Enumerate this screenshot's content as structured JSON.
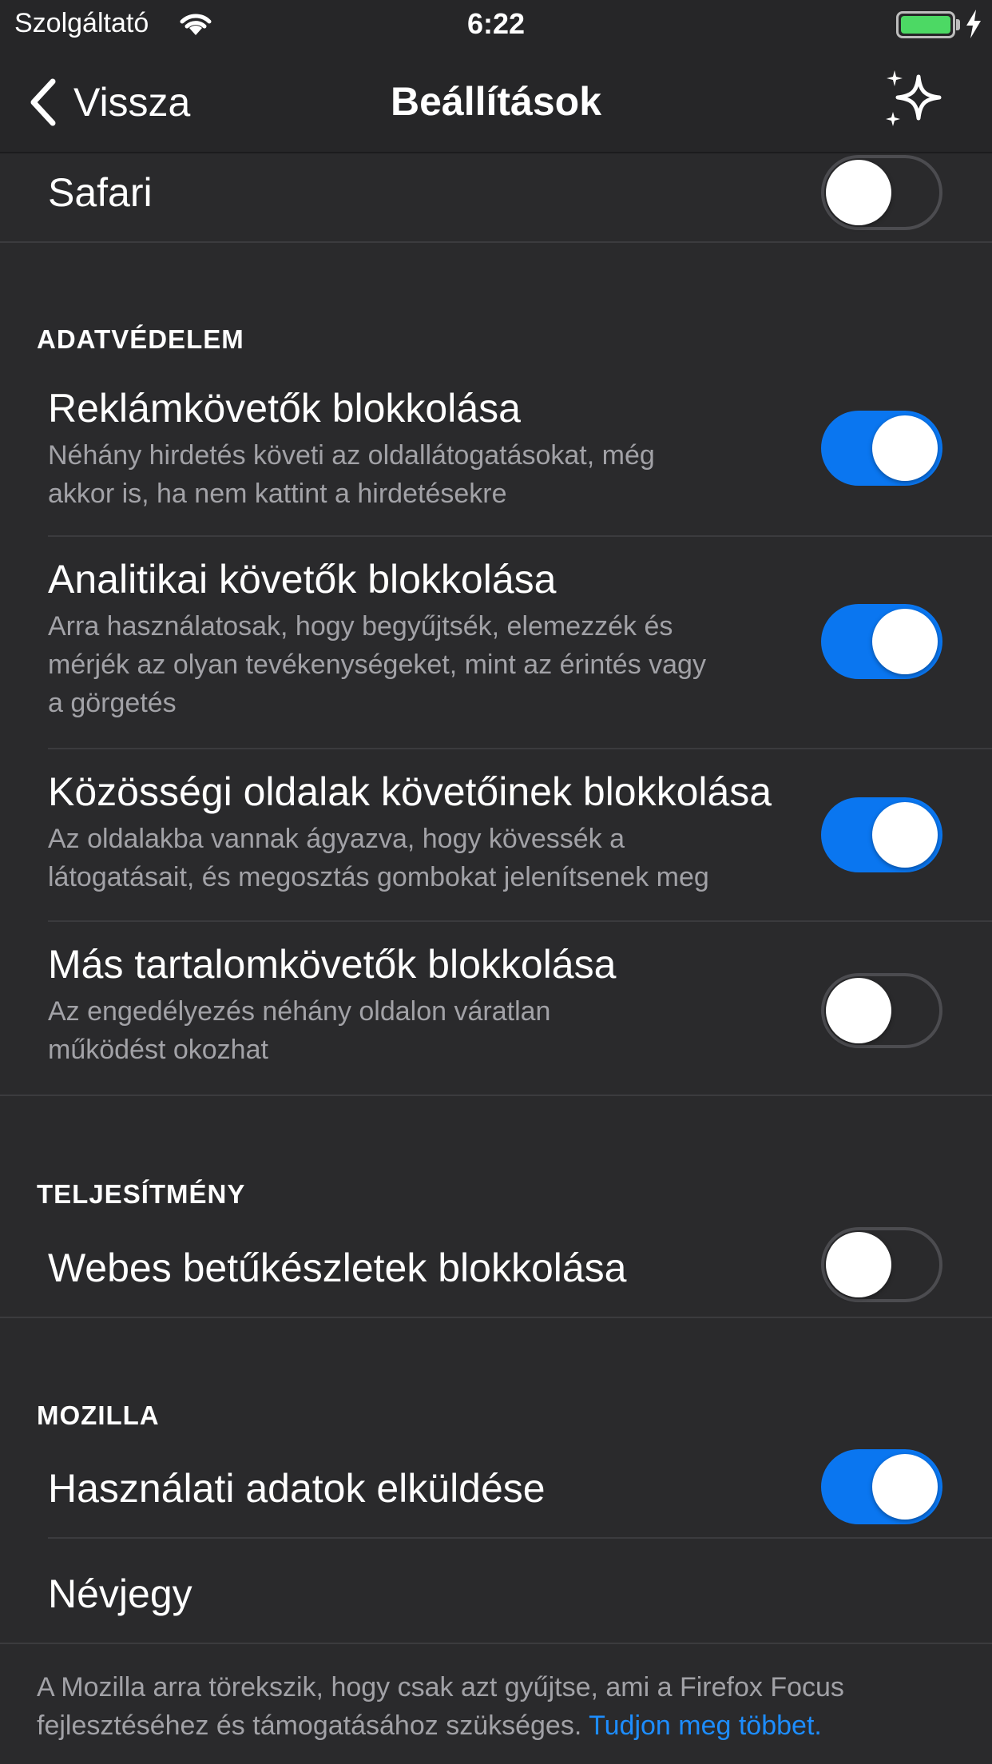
{
  "status_bar": {
    "carrier": "Szolgáltató",
    "time": "6:22",
    "battery_color": "#4cd964"
  },
  "nav": {
    "back_label": "Vissza",
    "title": "Beállítások",
    "action_icon": "sparkle-icon"
  },
  "rows_top": {
    "safari": {
      "title": "Safari",
      "toggle": false
    }
  },
  "privacy": {
    "header": "ADATVÉDELEM",
    "items": [
      {
        "title": "Reklámkövetők blokkolása",
        "desc_line1": "Néhány hirdetés követi az oldallátogatásokat, még",
        "desc_line2": "akkor is, ha nem kattint a hirdetésekre",
        "desc_line3": "",
        "toggle": true
      },
      {
        "title": "Analitikai követők blokkolása",
        "desc_line1": "Arra használatosak, hogy begyűjtsék, elemezzék és",
        "desc_line2": "mérjék az olyan tevékenységeket, mint az érintés vagy",
        "desc_line3": "a görgetés",
        "toggle": true
      },
      {
        "title": "Közösségi oldalak követőinek blokkolása",
        "desc_line1": "Az oldalakba vannak ágyazva, hogy kövessék a",
        "desc_line2": "látogatásait, és megosztás gombokat jelenítsenek meg",
        "desc_line3": "",
        "toggle": true
      },
      {
        "title": "Más tartalomkövetők blokkolása",
        "desc_line1": "Az engedélyezés néhány oldalon váratlan",
        "desc_line2": "működést okozhat",
        "desc_line3": "",
        "toggle": false
      }
    ]
  },
  "performance": {
    "header": "TELJESÍTMÉNY",
    "items": [
      {
        "title": "Webes betűkészletek blokkolása",
        "toggle": false
      }
    ]
  },
  "mozilla": {
    "header": "MOZILLA",
    "items": [
      {
        "title": "Használati adatok elküldése",
        "toggle": true
      },
      {
        "title": "Névjegy"
      }
    ]
  },
  "footer": {
    "text_line1": "A Mozilla arra törekszik, hogy csak azt gyűjtse, ami a Firefox Focus",
    "text_line2": "fejlesztéséhez és támogatásához szükséges.",
    "link": "Tudjon meg többet."
  },
  "colors": {
    "accent": "#0a76f0",
    "link": "#1d8dff",
    "background": "#2a2a2c"
  }
}
